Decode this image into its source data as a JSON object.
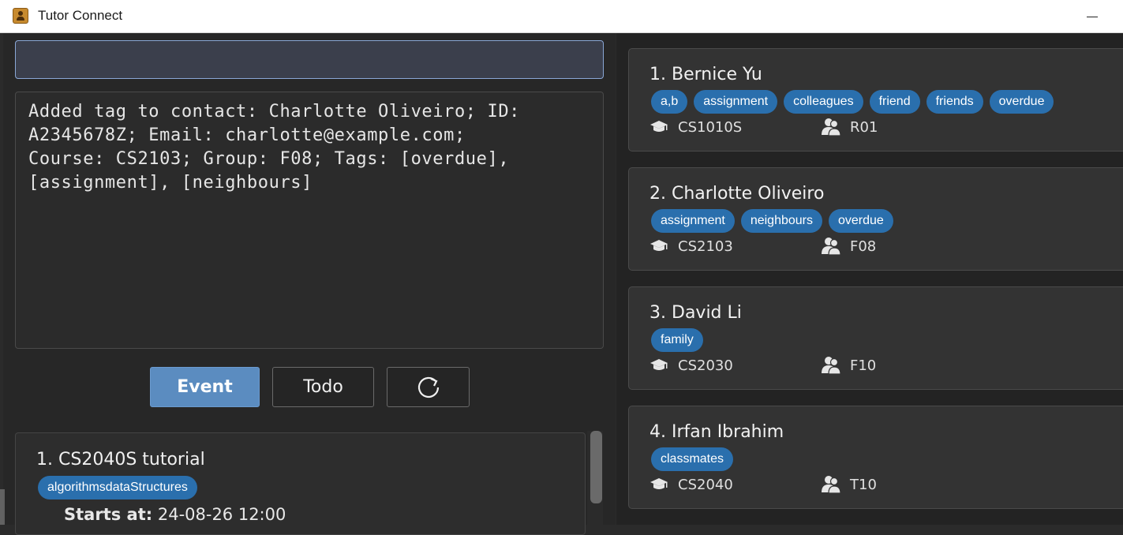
{
  "window": {
    "title": "Tutor Connect"
  },
  "command": {
    "value": ""
  },
  "result": {
    "text": "Added tag to contact: Charlotte Oliveiro; ID:\nA2345678Z; Email: charlotte@example.com;\nCourse: CS2103; Group: F08; Tags: [overdue],\n[assignment], [neighbours]"
  },
  "buttons": {
    "event_label": "Event",
    "todo_label": "Todo",
    "refresh_icon": "refresh-icon"
  },
  "events": [
    {
      "index": "1.",
      "title": "CS2040S tutorial",
      "tags": [
        "algorithmsdataStructures"
      ],
      "starts_label": "Starts at:",
      "starts_value": "24-08-26 12:00"
    }
  ],
  "contacts": [
    {
      "index": "1.",
      "name": "Bernice Yu",
      "tags": [
        "a,b",
        "assignment",
        "colleagues",
        "friend",
        "friends",
        "overdue"
      ],
      "course": "CS1010S",
      "group": "R01"
    },
    {
      "index": "2.",
      "name": "Charlotte Oliveiro",
      "tags": [
        "assignment",
        "neighbours",
        "overdue"
      ],
      "course": "CS2103",
      "group": "F08"
    },
    {
      "index": "3.",
      "name": "David Li",
      "tags": [
        "family"
      ],
      "course": "CS2030",
      "group": "F10"
    },
    {
      "index": "4.",
      "name": "Irfan Ibrahim",
      "tags": [
        "classmates"
      ],
      "course": "CS2040",
      "group": "T10"
    }
  ],
  "colors": {
    "tag_bg": "#2a6fad",
    "event_button": "#5b8cc0",
    "background": "#2b2b2b"
  }
}
